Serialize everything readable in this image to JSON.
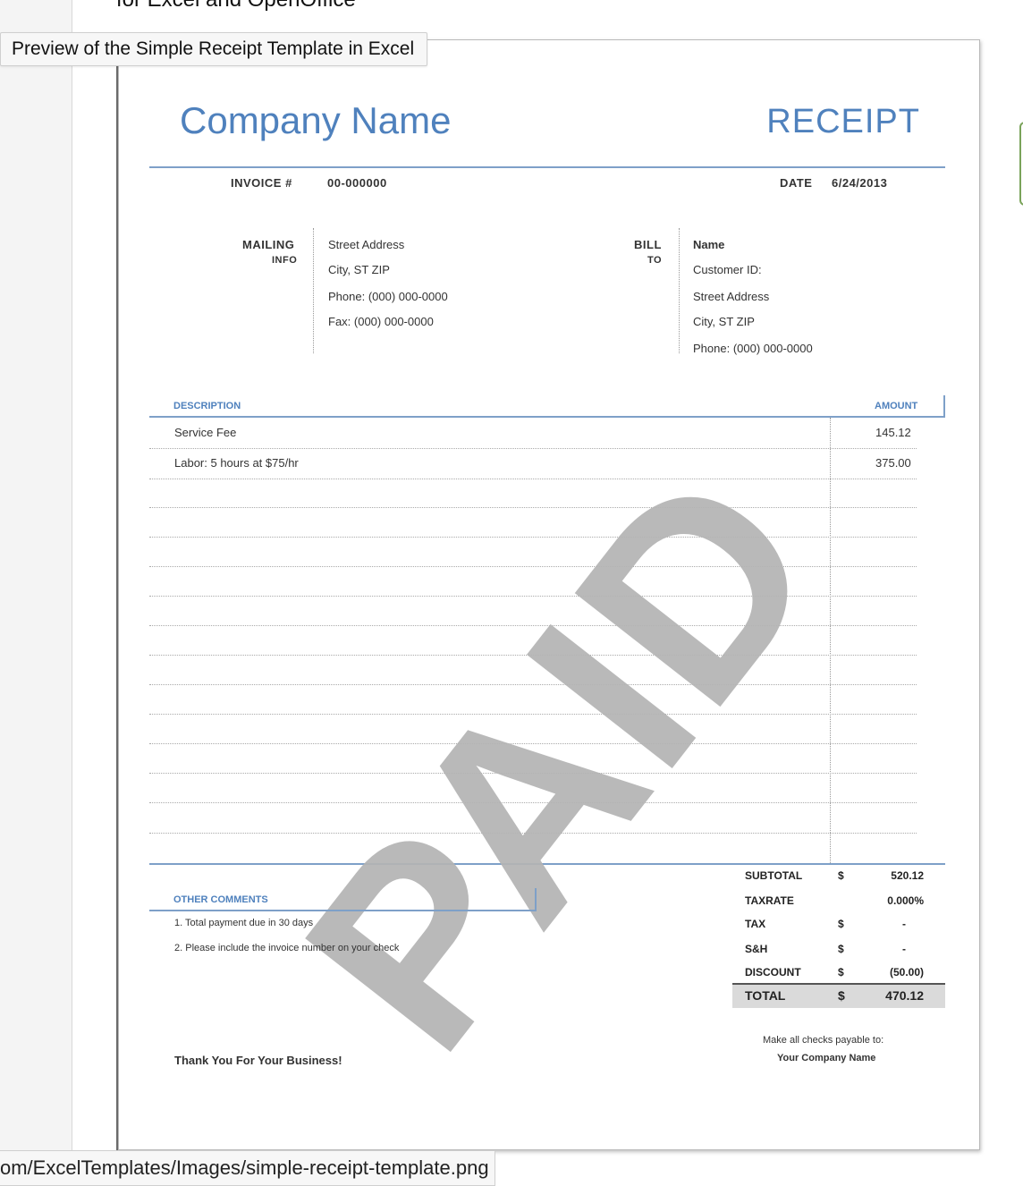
{
  "page": {
    "top_cut_text": "for Excel and OpenOffice",
    "tooltip": "Preview of the Simple Receipt Template in Excel",
    "status_url": "om/ExcelTemplates/Images/simple-receipt-template.png"
  },
  "receipt": {
    "company_name": "Company Name",
    "title": "RECEIPT",
    "invoice_label": "INVOICE #",
    "invoice_value": "00-000000",
    "date_label": "DATE",
    "date_value": "6/24/2013",
    "mailing_label_1": "MAILING",
    "mailing_label_2": "INFO",
    "mailing": [
      "Street Address",
      "City, ST  ZIP",
      "Phone: (000) 000-0000",
      "Fax: (000) 000-0000"
    ],
    "bill_label_1": "BILL",
    "bill_label_2": "TO",
    "bill_to": [
      "Name",
      "Customer ID:",
      "Street Address",
      "City, ST  ZIP",
      "Phone: (000) 000-0000"
    ],
    "table": {
      "col_description": "DESCRIPTION",
      "col_amount": "AMOUNT",
      "rows": [
        {
          "description": "Service Fee",
          "amount": "145.12"
        },
        {
          "description": "Labor: 5 hours at $75/hr",
          "amount": "375.00"
        }
      ]
    },
    "watermark": "PAID",
    "comments_label": "OTHER COMMENTS",
    "comments": [
      "1. Total payment due in 30 days",
      "2. Please include the invoice number on your check"
    ],
    "totals": {
      "subtotal_label": "SUBTOTAL",
      "subtotal_cur": "$",
      "subtotal": "520.12",
      "taxrate_label": "TAXRATE",
      "taxrate": "0.000%",
      "tax_label": "TAX",
      "tax_cur": "$",
      "tax": "-",
      "sh_label": "S&H",
      "sh_cur": "$",
      "sh": "-",
      "discount_label": "DISCOUNT",
      "discount_cur": "$",
      "discount": "(50.00)",
      "total_label": "TOTAL",
      "total_cur": "$",
      "total": "470.12"
    },
    "thanks": "Thank You For Your Business!",
    "payable_line": "Make all checks payable to:",
    "payable_name": "Your Company Name"
  }
}
